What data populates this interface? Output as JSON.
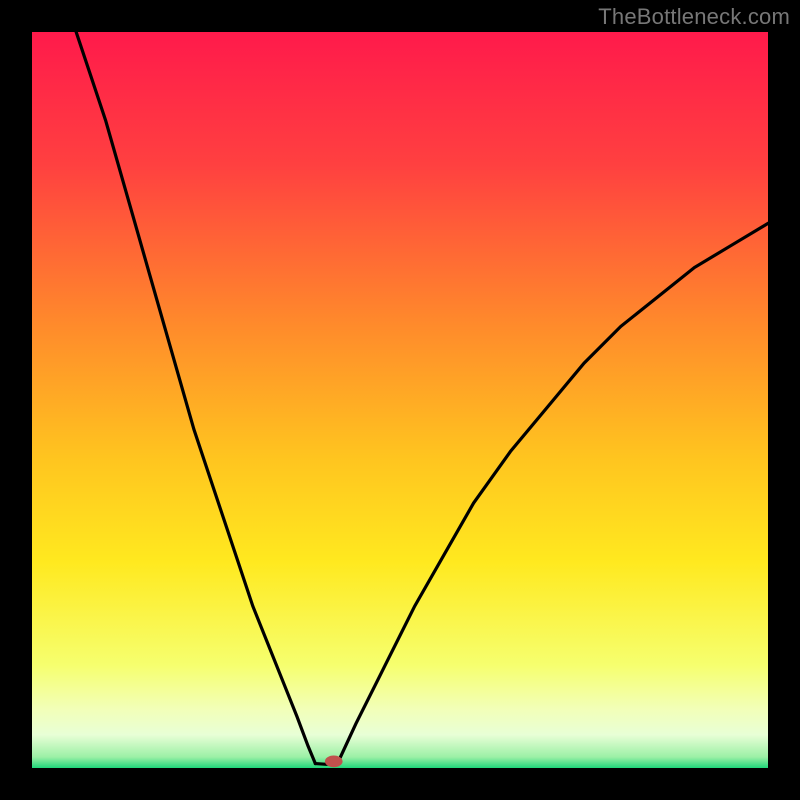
{
  "watermark": "TheBottleneck.com",
  "chart_data": {
    "type": "line",
    "title": "",
    "xlabel": "",
    "ylabel": "",
    "xlim": [
      0,
      100
    ],
    "ylim": [
      0,
      100
    ],
    "grid": false,
    "legend": false,
    "gradient_stops": [
      {
        "offset": 0.0,
        "color": "#ff1a4b"
      },
      {
        "offset": 0.18,
        "color": "#ff4040"
      },
      {
        "offset": 0.4,
        "color": "#ff8b2b"
      },
      {
        "offset": 0.58,
        "color": "#ffc51f"
      },
      {
        "offset": 0.72,
        "color": "#ffe91f"
      },
      {
        "offset": 0.86,
        "color": "#f6ff6e"
      },
      {
        "offset": 0.92,
        "color": "#f2ffb8"
      },
      {
        "offset": 0.955,
        "color": "#e8ffd6"
      },
      {
        "offset": 0.985,
        "color": "#9cf0a6"
      },
      {
        "offset": 1.0,
        "color": "#1fd67a"
      }
    ],
    "series": [
      {
        "name": "left-arm",
        "x": [
          6,
          8,
          10,
          12,
          14,
          16,
          18,
          20,
          22,
          24,
          26,
          28,
          30,
          32,
          34,
          36,
          37.5,
          38.5
        ],
        "y": [
          100,
          94,
          88,
          81,
          74,
          67,
          60,
          53,
          46,
          40,
          34,
          28,
          22,
          17,
          12,
          7,
          3,
          0.6
        ]
      },
      {
        "name": "flat-bottom",
        "x": [
          38.5,
          40,
          41.5
        ],
        "y": [
          0.6,
          0.5,
          0.6
        ]
      },
      {
        "name": "right-arm",
        "x": [
          41.5,
          44,
          48,
          52,
          56,
          60,
          65,
          70,
          75,
          80,
          85,
          90,
          95,
          100
        ],
        "y": [
          0.6,
          6,
          14,
          22,
          29,
          36,
          43,
          49,
          55,
          60,
          64,
          68,
          71,
          74
        ]
      }
    ],
    "marker": {
      "name": "bottleneck-point",
      "x": 41,
      "y": 0.9,
      "rx": 1.2,
      "ry": 0.8,
      "color": "#c0514d"
    }
  }
}
